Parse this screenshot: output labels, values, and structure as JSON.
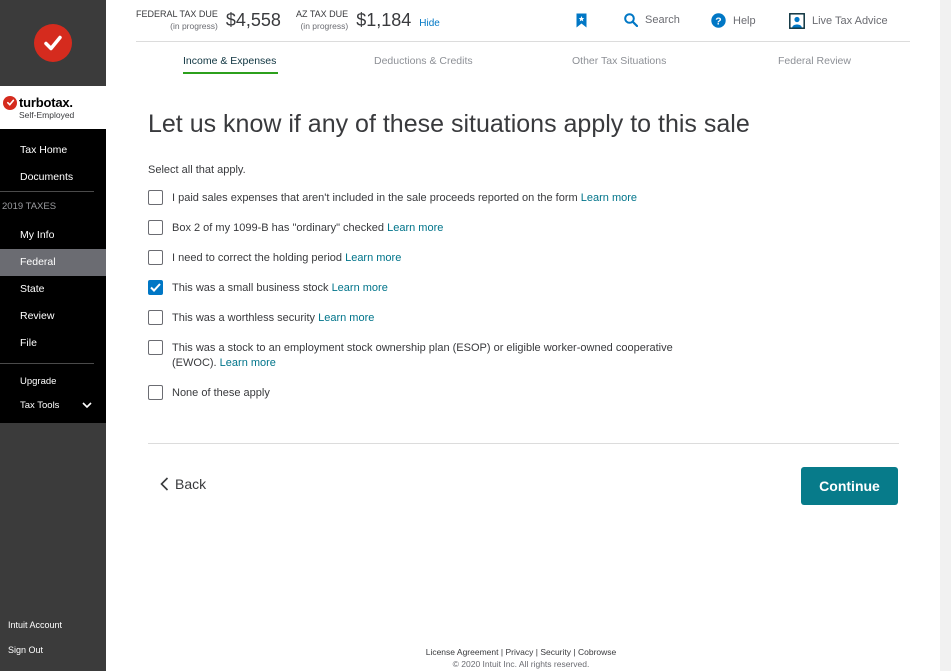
{
  "sidebar": {
    "brand_name": "turbotax.",
    "brand_sub": "Self-Employed",
    "items": [
      {
        "label": "Tax Home"
      },
      {
        "label": "Documents"
      }
    ],
    "section_label": "2019 TAXES",
    "section_items": [
      {
        "label": "My Info"
      },
      {
        "label": "Federal"
      },
      {
        "label": "State"
      },
      {
        "label": "Review"
      },
      {
        "label": "File"
      }
    ],
    "upgrade": "Upgrade",
    "tax_tools": "Tax Tools",
    "intuit_account": "Intuit Account",
    "sign_out": "Sign Out"
  },
  "header": {
    "federal_label": "FEDERAL TAX DUE",
    "federal_sub": "(in progress)",
    "federal_amount": "$4,558",
    "az_label": "AZ TAX DUE",
    "az_sub": "(in progress)",
    "az_amount": "$1,184",
    "hide": "Hide",
    "search": "Search",
    "help": "Help",
    "live_advice": "Live Tax Advice"
  },
  "tabs": [
    {
      "label": "Income & Expenses"
    },
    {
      "label": "Deductions & Credits"
    },
    {
      "label": "Other Tax Situations"
    },
    {
      "label": "Federal Review"
    }
  ],
  "main": {
    "title": "Let us know if any of these situations apply to this sale",
    "instruction": "Select all that apply.",
    "learn_more": "Learn more",
    "options": [
      {
        "text": "I paid sales expenses that aren't included in the sale proceeds reported on the form",
        "checked": false
      },
      {
        "text": "Box 2 of my 1099-B has \"ordinary\" checked",
        "checked": false
      },
      {
        "text": "I need to correct the holding period",
        "checked": false
      },
      {
        "text": "This was a small business stock",
        "checked": true
      },
      {
        "text": "This was a worthless security",
        "checked": false
      },
      {
        "text_line1": "This was a stock to an employment stock ownership plan (ESOP) or eligible worker-owned cooperative",
        "text_line2": "(EWOC).",
        "checked": false
      },
      {
        "text": "None of these apply",
        "checked": false
      }
    ],
    "back": "Back",
    "continue": "Continue"
  },
  "footer": {
    "license": "License Agreement",
    "privacy": "Privacy",
    "security": "Security",
    "cobrowse": "Cobrowse",
    "separator": "|",
    "copyright": "© 2020 Intuit Inc. All rights reserved."
  },
  "colors": {
    "accent": "#077b8a",
    "link": "#00748a",
    "checkbox": "#0077c5",
    "tab_underline": "#2ca01c",
    "brand_red": "#d52b1e"
  }
}
